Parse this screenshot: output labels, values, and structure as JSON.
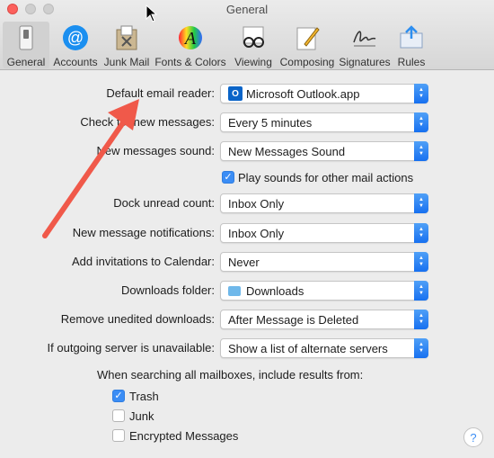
{
  "window": {
    "title": "General"
  },
  "toolbar": {
    "items": [
      {
        "label": "General",
        "icon": "general-switch-icon",
        "active": true
      },
      {
        "label": "Accounts",
        "icon": "at-sign-icon"
      },
      {
        "label": "Junk Mail",
        "icon": "junk-bin-icon"
      },
      {
        "label": "Fonts & Colors",
        "icon": "fonts-colors-icon"
      },
      {
        "label": "Viewing",
        "icon": "glasses-icon"
      },
      {
        "label": "Composing",
        "icon": "pencil-icon"
      },
      {
        "label": "Signatures",
        "icon": "signature-icon"
      },
      {
        "label": "Rules",
        "icon": "rules-envelope-icon"
      }
    ]
  },
  "settings": {
    "default_email_reader": {
      "label": "Default email reader:",
      "value": "Microsoft Outlook.app"
    },
    "check_new_messages": {
      "label": "Check for new messages:",
      "value": "Every 5 minutes"
    },
    "new_messages_sound": {
      "label": "New messages sound:",
      "value": "New Messages Sound"
    },
    "play_sounds": {
      "label": "Play sounds for other mail actions",
      "checked": true
    },
    "dock_unread_count": {
      "label": "Dock unread count:",
      "value": "Inbox Only"
    },
    "new_message_notifications": {
      "label": "New message notifications:",
      "value": "Inbox Only"
    },
    "add_invitations": {
      "label": "Add invitations to Calendar:",
      "value": "Never"
    },
    "downloads_folder": {
      "label": "Downloads folder:",
      "value": "Downloads"
    },
    "remove_unedited": {
      "label": "Remove unedited downloads:",
      "value": "After Message is Deleted"
    },
    "outgoing_unavailable": {
      "label": "If outgoing server is unavailable:",
      "value": "Show a list of alternate servers"
    },
    "search_heading": "When searching all mailboxes, include results from:",
    "search_trash": {
      "label": "Trash",
      "checked": true
    },
    "search_junk": {
      "label": "Junk",
      "checked": false
    },
    "search_encrypted": {
      "label": "Encrypted Messages",
      "checked": false
    }
  },
  "help": {
    "label": "?"
  },
  "annotation": {
    "color": "#f0594a"
  }
}
